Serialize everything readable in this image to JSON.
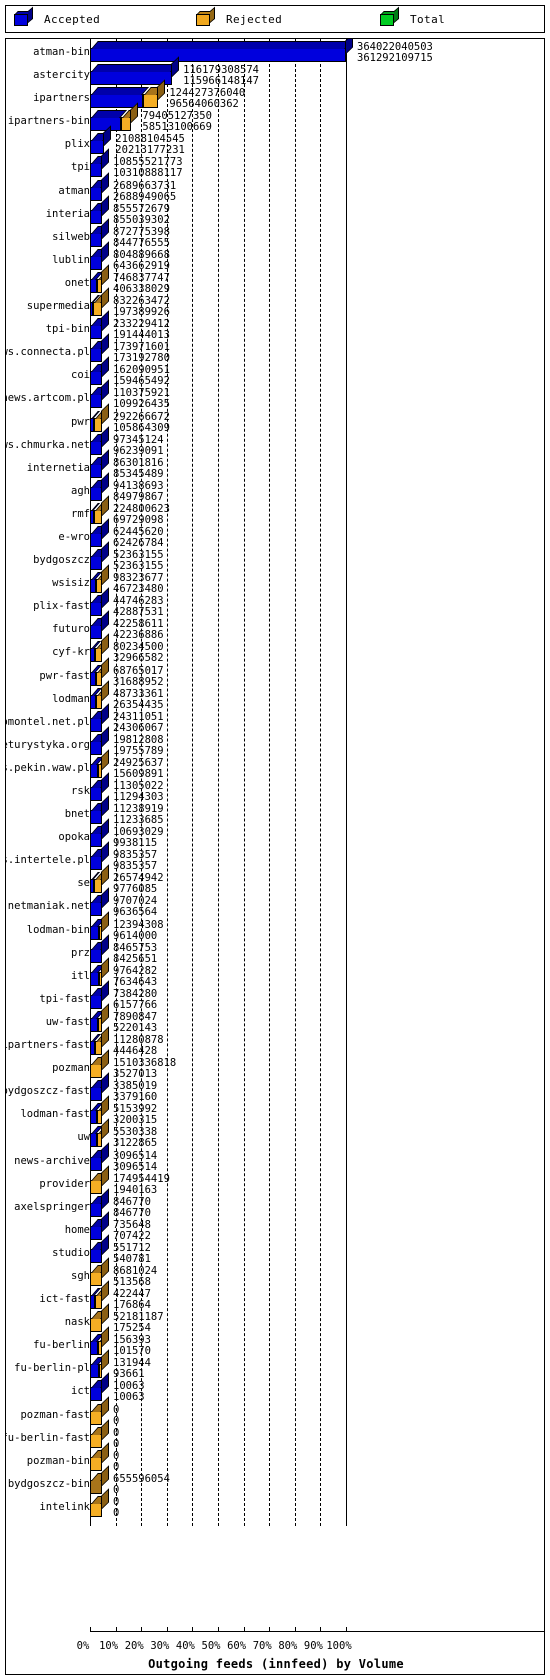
{
  "legend": {
    "items": [
      {
        "label": "Accepted",
        "color": "#0000dd",
        "icon": "cube-icon"
      },
      {
        "label": "Rejected",
        "color": "#f0a81e",
        "icon": "cube-icon"
      },
      {
        "label": "Total",
        "color": "#00cc22",
        "icon": "cube-icon"
      }
    ]
  },
  "axis": {
    "title": "Outgoing feeds (innfeed) by Volume",
    "ticks": [
      "0%",
      "10%",
      "20%",
      "30%",
      "40%",
      "50%",
      "60%",
      "70%",
      "80%",
      "90%",
      "100%"
    ],
    "tick_values": [
      0,
      10,
      20,
      30,
      40,
      50,
      60,
      70,
      80,
      90,
      100
    ],
    "grid": true
  },
  "colors": {
    "accepted": "#0000dd",
    "accepted_top": "#0000aa",
    "accepted_side": "#000088",
    "rejected": "#f5ae24",
    "rejected_top": "#a8741a",
    "rejected_side": "#8a5f14",
    "total": "#00cc22",
    "outline": "#000000",
    "background": "#ffffff"
  },
  "chart_data": {
    "type": "bar",
    "orientation": "horizontal",
    "stacked": true,
    "title": "Outgoing feeds (innfeed) by Volume",
    "xlabel": "Outgoing feeds (innfeed) by Volume",
    "ylabel": "",
    "xlim": [
      0,
      100
    ],
    "xunit": "percent",
    "grid": true,
    "legend_position": "top",
    "categories": [
      "atman-bin",
      "astercity",
      "ipartners",
      "ipartners-bin",
      "plix",
      "tpi",
      "atman",
      "interia",
      "silweb",
      "lublin",
      "onet",
      "supermedia",
      "tpi-bin",
      "news.connecta.pl",
      "coi",
      "news.artcom.pl",
      "pwr",
      "news.chmurka.net",
      "internetia",
      "agh",
      "rmf",
      "e-wro",
      "bydgoszcz",
      "wsisiz",
      "plix-fast",
      "futuro",
      "cyf-kr",
      "pwr-fast",
      "lodman",
      "news.promontel.net.pl",
      "news.eturystyka.org",
      "news.pekin.waw.pl",
      "rsk",
      "bnet",
      "opoka",
      "news.intertele.pl",
      "se",
      "news.netmaniak.net",
      "lodman-bin",
      "prz",
      "itl",
      "tpi-fast",
      "uw-fast",
      "ipartners-fast",
      "pozman",
      "bydgoszcz-fast",
      "lodman-fast",
      "uw",
      "news-archive",
      "provider",
      "axelspringer",
      "home",
      "studio",
      "sgh",
      "ict-fast",
      "nask",
      "fu-berlin",
      "fu-berlin-pl",
      "ict",
      "pozman-fast",
      "fu-berlin-fast",
      "pozman-bin",
      "bydgoszcz-bin",
      "intelink"
    ],
    "series": [
      {
        "name": "Total",
        "values": [
          364022040503,
          116179308574,
          124427376040,
          79405127350,
          21088104545,
          10855521773,
          2689663731,
          855572679,
          872775398,
          804889668,
          746837747,
          832263472,
          233229412,
          173971601,
          162090951,
          110375921,
          292266672,
          97345124,
          86301816,
          94138693,
          224800623,
          62445620,
          52363155,
          98323677,
          44746283,
          42258611,
          80234500,
          68765017,
          48733361,
          24311051,
          19812808,
          24925637,
          11305022,
          11238919,
          10693029,
          9835357,
          26574942,
          9707024,
          12394308,
          8465753,
          9764282,
          7384280,
          7890847,
          11280878,
          1510336818,
          3385019,
          5153992,
          5530338,
          3096514,
          174954419,
          846770,
          735648,
          551712,
          8681024,
          422447,
          52181187,
          156393,
          131944,
          10063,
          0,
          0,
          0,
          655596054,
          0
        ]
      },
      {
        "name": "Accepted",
        "values": [
          361292109715,
          115966148147,
          96564060362,
          58513100669,
          20213177231,
          10310888117,
          2688949065,
          855039302,
          844776555,
          643662919,
          406338029,
          197389926,
          191444013,
          173192780,
          159465492,
          109926435,
          105864309,
          96239091,
          85345489,
          84979867,
          69729098,
          62426784,
          52363155,
          46723480,
          42887531,
          42236886,
          32966582,
          31688952,
          26354435,
          24306067,
          19755789,
          15609891,
          11294303,
          11233685,
          9938115,
          9835357,
          9776085,
          9636564,
          9614000,
          8425651,
          7634643,
          6157766,
          5220143,
          4446428,
          3527013,
          3379160,
          3200315,
          3122865,
          3096514,
          1940163,
          846770,
          707422,
          540781,
          513568,
          176864,
          175254,
          101570,
          93661,
          10063,
          0,
          0,
          0,
          0,
          0
        ]
      }
    ],
    "bar_fraction_of_max": [
      1.0,
      0.3209,
      0.267,
      0.1618,
      0.0559,
      0.0285,
      0.00744,
      0.00237,
      0.00234,
      0.00178,
      0.00112,
      0.000546,
      0.00053,
      0.000479,
      0.000441,
      0.000304,
      0.000293,
      0.000266,
      0.000236,
      0.000235,
      0.000193,
      0.000173,
      0.000145,
      0.000129,
      0.000119,
      0.000117,
      9.12e-05,
      8.77e-05,
      7.29e-05,
      6.72e-05,
      5.47e-05,
      4.32e-05,
      3.12e-05,
      3.11e-05,
      2.75e-05,
      2.72e-05,
      2.7e-05,
      2.67e-05,
      2.66e-05,
      2.33e-05,
      2.11e-05,
      1.7e-05,
      1.44e-05,
      1.23e-05,
      9.76e-06,
      9.35e-06,
      8.86e-06,
      8.64e-06,
      8.57e-06,
      5.37e-06,
      2.34e-06,
      1.96e-06,
      1.5e-06,
      1.42e-06,
      4.9e-07,
      4.85e-07,
      2.81e-07,
      2.59e-07,
      2.79e-08,
      0,
      0,
      0,
      0,
      0
    ]
  },
  "rows": [
    {
      "name": "atman-bin",
      "total": "364022040503",
      "accepted": "361292109715",
      "pct": 100,
      "acc_pct": 99.25
    },
    {
      "name": "astercity",
      "total": "116179308574",
      "accepted": "115966148147",
      "pct": 32.09,
      "acc_pct": 99.82
    },
    {
      "name": "ipartners",
      "total": "124427376040",
      "accepted": "96564060362",
      "pct": 26.7,
      "acc_pct": 77.61
    },
    {
      "name": "ipartners-bin",
      "total": "79405127350",
      "accepted": "58513100669",
      "pct": 16.18,
      "acc_pct": 73.69
    },
    {
      "name": "plix",
      "total": "21088104545",
      "accepted": "20213177231",
      "pct": 5.59,
      "acc_pct": 95.85
    },
    {
      "name": "tpi",
      "total": "10855521773",
      "accepted": "10310888117",
      "pct": 2.85,
      "acc_pct": 94.98
    },
    {
      "name": "atman",
      "total": "2689663731",
      "accepted": "2688949065",
      "pct": 0.74,
      "acc_pct": 99.97
    },
    {
      "name": "interia",
      "total": "855572679",
      "accepted": "855039302",
      "pct": 0.24,
      "acc_pct": 99.94
    },
    {
      "name": "silweb",
      "total": "872775398",
      "accepted": "844776555",
      "pct": 0.23,
      "acc_pct": 96.79
    },
    {
      "name": "lublin",
      "total": "804889668",
      "accepted": "643662919",
      "pct": 0.18,
      "acc_pct": 79.97
    },
    {
      "name": "onet",
      "total": "746837747",
      "accepted": "406338029",
      "pct": 0.11,
      "acc_pct": 54.41
    },
    {
      "name": "supermedia",
      "total": "832263472",
      "accepted": "197389926",
      "pct": 0.05,
      "acc_pct": 23.72
    },
    {
      "name": "tpi-bin",
      "total": "233229412",
      "accepted": "191444013",
      "pct": 0.05,
      "acc_pct": 82.08
    },
    {
      "name": "news.connecta.pl",
      "total": "173971601",
      "accepted": "173192780",
      "pct": 0.05,
      "acc_pct": 99.55
    },
    {
      "name": "coi",
      "total": "162090951",
      "accepted": "159465492",
      "pct": 0.04,
      "acc_pct": 98.38
    },
    {
      "name": "news.artcom.pl",
      "total": "110375921",
      "accepted": "109926435",
      "pct": 0.03,
      "acc_pct": 99.59
    },
    {
      "name": "pwr",
      "total": "292266672",
      "accepted": "105864309",
      "pct": 0.03,
      "acc_pct": 36.22
    },
    {
      "name": "news.chmurka.net",
      "total": "97345124",
      "accepted": "96239091",
      "pct": 0.03,
      "acc_pct": 98.86
    },
    {
      "name": "internetia",
      "total": "86301816",
      "accepted": "85345489",
      "pct": 0.02,
      "acc_pct": 98.89
    },
    {
      "name": "agh",
      "total": "94138693",
      "accepted": "84979867",
      "pct": 0.02,
      "acc_pct": 90.27
    },
    {
      "name": "rmf",
      "total": "224800623",
      "accepted": "69729098",
      "pct": 0.02,
      "acc_pct": 31.02
    },
    {
      "name": "e-wro",
      "total": "62445620",
      "accepted": "62426784",
      "pct": 0.02,
      "acc_pct": 99.97
    },
    {
      "name": "bydgoszcz",
      "total": "52363155",
      "accepted": "52363155",
      "pct": 0.01,
      "acc_pct": 100
    },
    {
      "name": "wsisiz",
      "total": "98323677",
      "accepted": "46723480",
      "pct": 0.01,
      "acc_pct": 47.52
    },
    {
      "name": "plix-fast",
      "total": "44746283",
      "accepted": "42887531",
      "pct": 0.01,
      "acc_pct": 95.85
    },
    {
      "name": "futuro",
      "total": "42258611",
      "accepted": "42236886",
      "pct": 0.01,
      "acc_pct": 99.95
    },
    {
      "name": "cyf-kr",
      "total": "80234500",
      "accepted": "32966582",
      "pct": 0.01,
      "acc_pct": 41.09
    },
    {
      "name": "pwr-fast",
      "total": "68765017",
      "accepted": "31688952",
      "pct": 0.01,
      "acc_pct": 46.08
    },
    {
      "name": "lodman",
      "total": "48733361",
      "accepted": "26354435",
      "pct": 0.01,
      "acc_pct": 54.08
    },
    {
      "name": "news.promontel.net.pl",
      "total": "24311051",
      "accepted": "24306067",
      "pct": 0.01,
      "acc_pct": 99.98
    },
    {
      "name": "news.eturystyka.org",
      "total": "19812808",
      "accepted": "19755789",
      "pct": 0.01,
      "acc_pct": 99.71
    },
    {
      "name": "news.pekin.waw.pl",
      "total": "24925637",
      "accepted": "15609891",
      "pct": 0,
      "acc_pct": 62.63
    },
    {
      "name": "rsk",
      "total": "11305022",
      "accepted": "11294303",
      "pct": 0,
      "acc_pct": 99.91
    },
    {
      "name": "bnet",
      "total": "11238919",
      "accepted": "11233685",
      "pct": 0,
      "acc_pct": 99.95
    },
    {
      "name": "opoka",
      "total": "10693029",
      "accepted": "9938115",
      "pct": 0,
      "acc_pct": 92.94
    },
    {
      "name": "news.intertele.pl",
      "total": "9835357",
      "accepted": "9835357",
      "pct": 0,
      "acc_pct": 100
    },
    {
      "name": "se",
      "total": "26574942",
      "accepted": "9776085",
      "pct": 0,
      "acc_pct": 36.78
    },
    {
      "name": "news.netmaniak.net",
      "total": "9707024",
      "accepted": "9636564",
      "pct": 0,
      "acc_pct": 99.27
    },
    {
      "name": "lodman-bin",
      "total": "12394308",
      "accepted": "9614000",
      "pct": 0,
      "acc_pct": 77.57
    },
    {
      "name": "prz",
      "total": "8465753",
      "accepted": "8425651",
      "pct": 0,
      "acc_pct": 99.53
    },
    {
      "name": "itl",
      "total": "9764282",
      "accepted": "7634643",
      "pct": 0,
      "acc_pct": 78.19
    },
    {
      "name": "tpi-fast",
      "total": "7384280",
      "accepted": "6157766",
      "pct": 0,
      "acc_pct": 83.39
    },
    {
      "name": "uw-fast",
      "total": "7890847",
      "accepted": "5220143",
      "pct": 0,
      "acc_pct": 66.15
    },
    {
      "name": "ipartners-fast",
      "total": "11280878",
      "accepted": "4446428",
      "pct": 0,
      "acc_pct": 39.41
    },
    {
      "name": "pozman",
      "total": "1510336818",
      "accepted": "3527013",
      "pct": 0,
      "acc_pct": 0.23
    },
    {
      "name": "bydgoszcz-fast",
      "total": "3385019",
      "accepted": "3379160",
      "pct": 0,
      "acc_pct": 99.83
    },
    {
      "name": "lodman-fast",
      "total": "5153992",
      "accepted": "3200315",
      "pct": 0,
      "acc_pct": 62.09
    },
    {
      "name": "uw",
      "total": "5530338",
      "accepted": "3122865",
      "pct": 0,
      "acc_pct": 56.47
    },
    {
      "name": "news-archive",
      "total": "3096514",
      "accepted": "3096514",
      "pct": 0,
      "acc_pct": 100
    },
    {
      "name": "provider",
      "total": "174954419",
      "accepted": "1940163",
      "pct": 0,
      "acc_pct": 1.11
    },
    {
      "name": "axelspringer",
      "total": "846770",
      "accepted": "846770",
      "pct": 0,
      "acc_pct": 100
    },
    {
      "name": "home",
      "total": "735648",
      "accepted": "707422",
      "pct": 0,
      "acc_pct": 96.16
    },
    {
      "name": "studio",
      "total": "551712",
      "accepted": "540781",
      "pct": 0,
      "acc_pct": 98.02
    },
    {
      "name": "sgh",
      "total": "8681024",
      "accepted": "513568",
      "pct": 0,
      "acc_pct": 5.92
    },
    {
      "name": "ict-fast",
      "total": "422447",
      "accepted": "176864",
      "pct": 0,
      "acc_pct": 41.87
    },
    {
      "name": "nask",
      "total": "52181187",
      "accepted": "175254",
      "pct": 0,
      "acc_pct": 0.34
    },
    {
      "name": "fu-berlin",
      "total": "156393",
      "accepted": "101570",
      "pct": 0,
      "acc_pct": 64.95
    },
    {
      "name": "fu-berlin-pl",
      "total": "131944",
      "accepted": "93661",
      "pct": 0,
      "acc_pct": 70.98
    },
    {
      "name": "ict",
      "total": "10063",
      "accepted": "10063",
      "pct": 0,
      "acc_pct": 100
    },
    {
      "name": "pozman-fast",
      "total": "0",
      "accepted": "0",
      "pct": 0,
      "acc_pct": 0
    },
    {
      "name": "fu-berlin-fast",
      "total": "0",
      "accepted": "0",
      "pct": 0,
      "acc_pct": 0
    },
    {
      "name": "pozman-bin",
      "total": "0",
      "accepted": "0",
      "pct": 0,
      "acc_pct": 0
    },
    {
      "name": "bydgoszcz-bin",
      "total": "655596054",
      "accepted": "0",
      "pct": 0,
      "acc_pct": 0
    },
    {
      "name": "intelink",
      "total": "0",
      "accepted": "0",
      "pct": 0,
      "acc_pct": 0
    }
  ]
}
